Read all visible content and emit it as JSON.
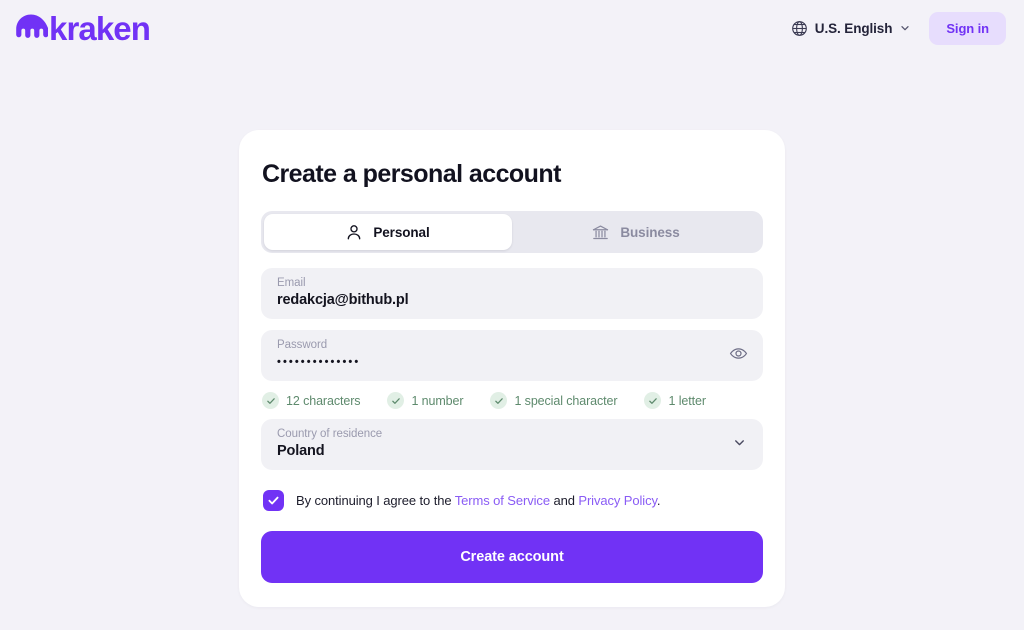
{
  "header": {
    "logo_text": "kraken",
    "logo_icon": "kraken-octopus-icon",
    "globe_icon": "globe-icon",
    "language": "U.S. English",
    "chevron_icon": "chevron-down-icon",
    "signin_label": "Sign in"
  },
  "card": {
    "title": "Create a personal account",
    "tabs": [
      {
        "label": "Personal",
        "icon": "person-icon",
        "active": true
      },
      {
        "label": "Business",
        "icon": "bank-icon",
        "active": false
      }
    ],
    "email": {
      "label": "Email",
      "value": "redakcja@bithub.pl"
    },
    "password": {
      "label": "Password",
      "value": "••••••••••••••",
      "toggle_icon": "eye-icon"
    },
    "password_rules": [
      {
        "label": "12 characters",
        "met": true
      },
      {
        "label": "1 number",
        "met": true
      },
      {
        "label": "1 special character",
        "met": true
      },
      {
        "label": "1 letter",
        "met": true
      }
    ],
    "country": {
      "label": "Country of residence",
      "value": "Poland",
      "chevron_icon": "chevron-down-icon"
    },
    "consent": {
      "checked": true,
      "prefix": "By continuing I agree to the ",
      "terms_link": "Terms of Service",
      "conjunction": " and ",
      "privacy_link": "Privacy Policy",
      "suffix": "."
    },
    "submit_label": "Create account"
  },
  "colors": {
    "brand_purple": "#7132f5",
    "link_purple": "#8a5cf5",
    "signin_bg": "#e7ddfd",
    "page_bg": "#f3f2f8",
    "field_bg": "#f1f1f5",
    "success_green": "#5e8a6d"
  }
}
